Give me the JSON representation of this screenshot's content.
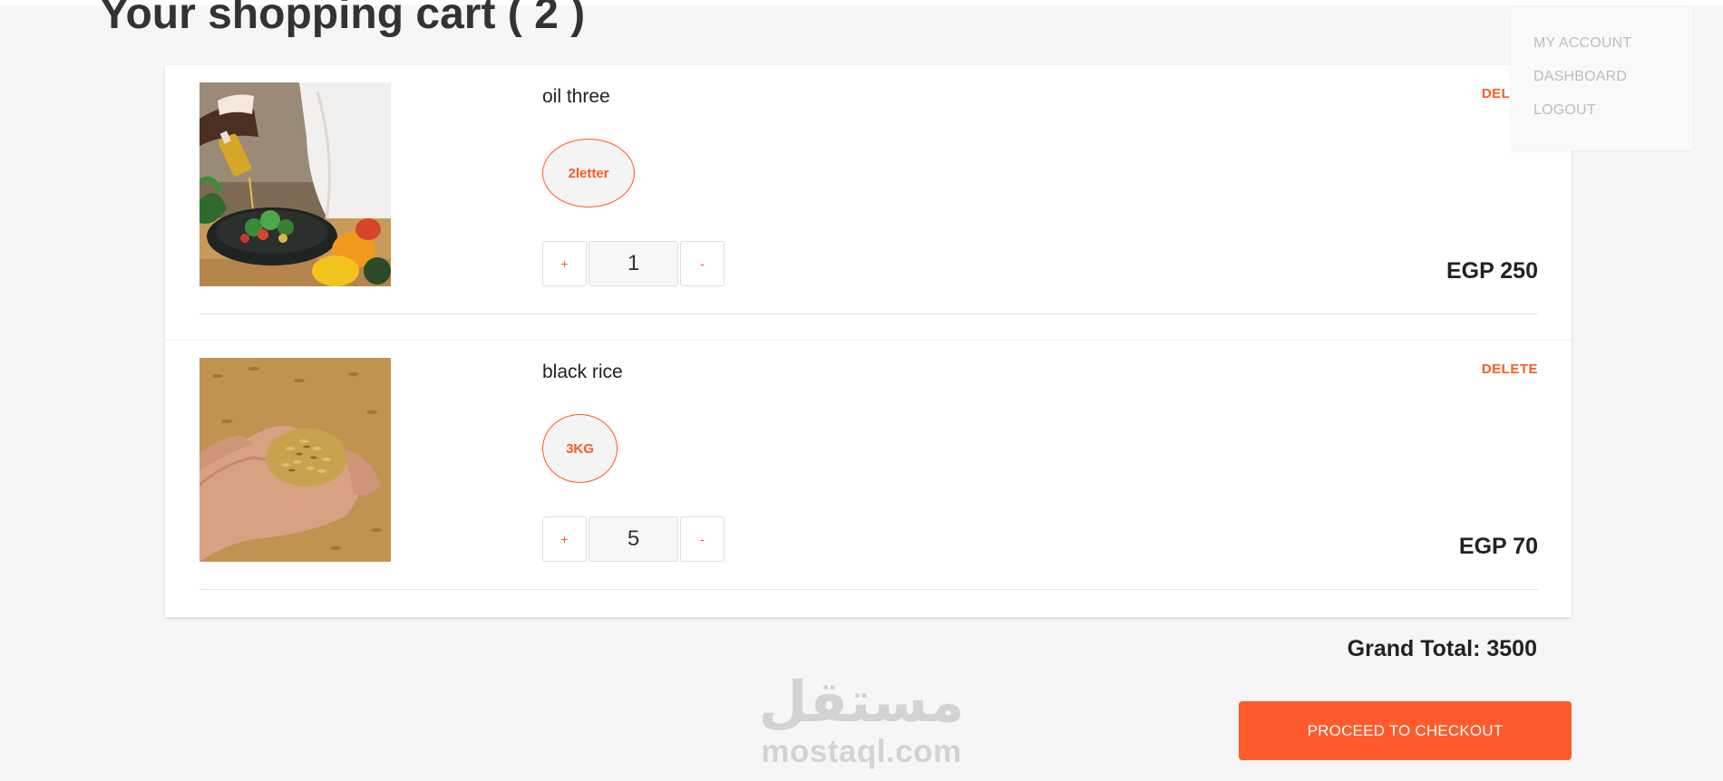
{
  "page": {
    "title": "Your shopping cart ( 2 )"
  },
  "account_menu": {
    "items": [
      "MY ACCOUNT",
      "DASHBOARD",
      "LOGOUT"
    ]
  },
  "cart": {
    "items": [
      {
        "name": "oil three",
        "variant": "2letter",
        "quantity": "1",
        "plus_label": "+",
        "minus_label": "-",
        "delete_label": "DELETE",
        "price": "EGP 250",
        "image_icon": "olive-oil-cooking-photo"
      },
      {
        "name": "black rice",
        "variant": "3KG",
        "quantity": "5",
        "plus_label": "+",
        "minus_label": "-",
        "delete_label": "DELETE",
        "price": "EGP 70",
        "image_icon": "rice-grains-in-hand-photo"
      }
    ]
  },
  "summary": {
    "grand_total": "Grand Total: 3500",
    "checkout_label": "PROCEED TO CHECKOUT"
  },
  "watermark": {
    "arabic": "مستقل",
    "latin": "mostaql.com"
  },
  "colors": {
    "accent": "#ff5a1f",
    "checkout_bg": "#ff5a2b",
    "page_bg": "#f6f6f6"
  }
}
